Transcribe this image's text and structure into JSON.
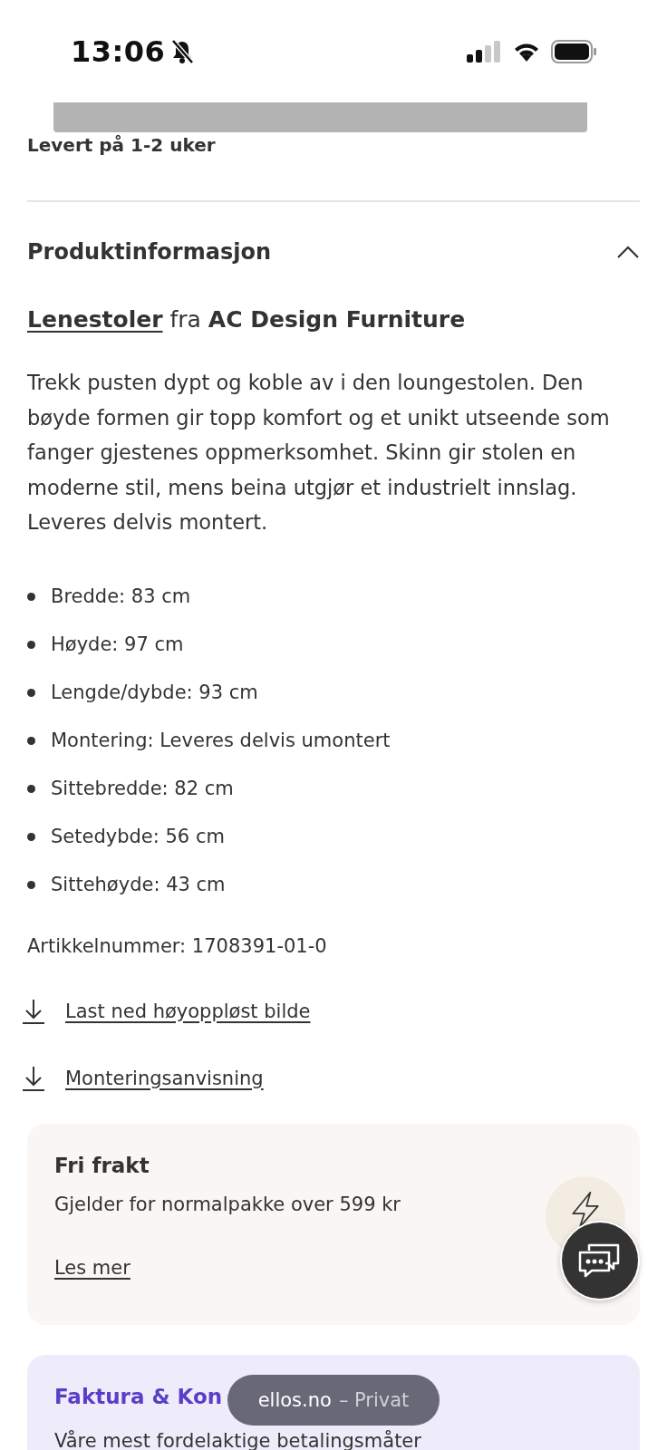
{
  "status_bar": {
    "time": "13:06",
    "silent": true
  },
  "delivery": {
    "text": "Levert på 1-2 uker"
  },
  "section": {
    "title": "Produktinformasjon",
    "expanded": true
  },
  "category_line": {
    "category": "Lenestoler",
    "connector": "fra",
    "brand": "AC Design Furniture"
  },
  "description": "Trekk pusten dypt og koble av i den loungestolen. Den bøyde formen gir topp komfort og et unikt utseende som fanger gjestenes oppmerksomhet. Skinn gir stolen en moderne stil, mens beina utgjør et industrielt innslag. Leveres delvis montert.",
  "specs": [
    "Bredde: 83 cm",
    "Høyde: 97 cm",
    "Lengde/dybde: 93 cm",
    "Montering: Leveres delvis umontert",
    "Sittebredde: 82 cm",
    "Setedybde: 56 cm",
    "Sittehøyde: 43 cm"
  ],
  "article_number": "Artikkelnummer: 1708391-01-0",
  "downloads": [
    "Last ned høyoppløst bilde",
    "Monteringsanvisning"
  ],
  "cards": [
    {
      "kind": "shipping",
      "title": "Fri frakt",
      "text": "Gjelder for normalpakke over 599 kr",
      "link": "Les mer"
    },
    {
      "kind": "payment",
      "title": "Faktura & Kon",
      "text": "Våre mest fordelaktige betalingsmåter"
    }
  ],
  "browser_pill": {
    "site": "ellos.no",
    "mode": "– Privat"
  }
}
